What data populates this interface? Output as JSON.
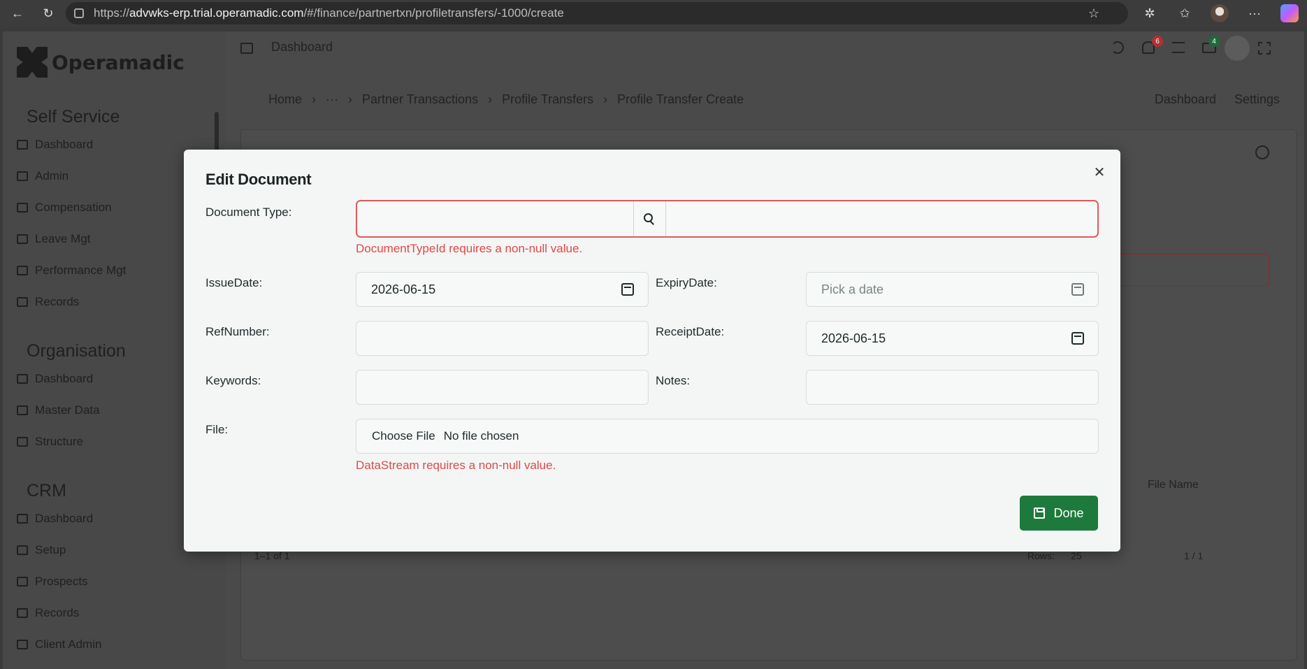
{
  "browser": {
    "url_prefix": "https://",
    "url_host": "advwks-erp.trial.operamadic.com",
    "url_path": "/#/finance/partnertxn/profiletransfers/-1000/create"
  },
  "app": {
    "brand": "Operamadic",
    "topbar_title": "Dashboard",
    "notifications_count": "6",
    "mail_count": "4",
    "breadcrumb": [
      "Home",
      "···",
      "Partner Transactions",
      "Profile Transfers",
      "Profile Transfer Create"
    ],
    "top_links": [
      "Dashboard",
      "Settings"
    ]
  },
  "sidebar": {
    "sections": [
      {
        "title": "Self Service",
        "items": [
          "Dashboard",
          "Admin",
          "Compensation",
          "Leave Mgt",
          "Performance Mgt",
          "Records"
        ]
      },
      {
        "title": "Organisation",
        "items": [
          "Dashboard",
          "Master Data",
          "Structure"
        ]
      },
      {
        "title": "CRM",
        "items": [
          "Dashboard",
          "Setup",
          "Prospects",
          "Records",
          "Client Admin"
        ]
      }
    ]
  },
  "background": {
    "file_name_header": "File Name",
    "pager_text": "1–1 of 1",
    "rows_label": "Rows:",
    "rows_value": "25",
    "page_text": "1 / 1"
  },
  "modal": {
    "title": "Edit Document",
    "labels": {
      "document_type": "Document Type:",
      "issue_date": "IssueDate:",
      "expiry_date": "ExpiryDate:",
      "ref_number": "RefNumber:",
      "receipt_date": "ReceiptDate:",
      "keywords": "Keywords:",
      "notes": "Notes:",
      "file": "File:"
    },
    "values": {
      "issue_date": "2026-06-15",
      "expiry_date_placeholder": "Pick a date",
      "receipt_date": "2026-06-15",
      "file_button": "Choose File",
      "file_status": "No file chosen"
    },
    "errors": {
      "document_type": "DocumentTypeId requires a non-null value.",
      "file": "DataStream requires a non-null value."
    },
    "done_label": "Done"
  },
  "colors": {
    "error": "#e04848",
    "primary_button": "#1e7a3c",
    "modal_bg": "#f4f6f5"
  }
}
